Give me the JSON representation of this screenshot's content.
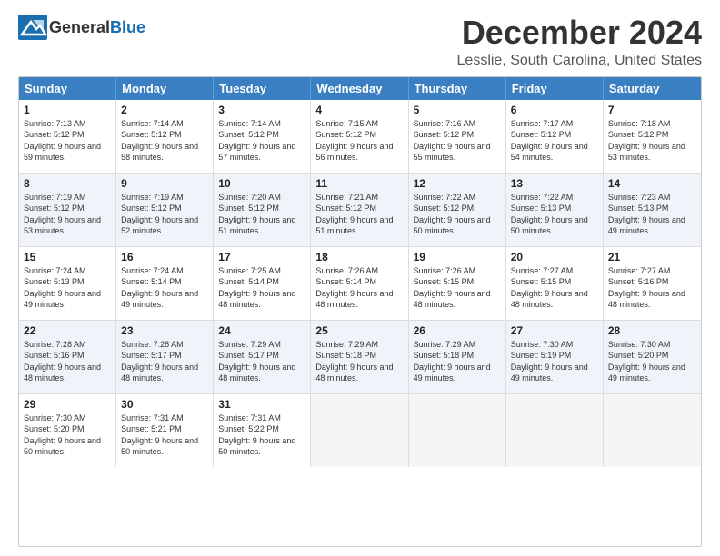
{
  "header": {
    "logo_general": "General",
    "logo_blue": "Blue",
    "month_title": "December 2024",
    "location": "Lesslie, South Carolina, United States"
  },
  "days_of_week": [
    "Sunday",
    "Monday",
    "Tuesday",
    "Wednesday",
    "Thursday",
    "Friday",
    "Saturday"
  ],
  "weeks": [
    {
      "cells": [
        {
          "day": "1",
          "sunrise": "Sunrise: 7:13 AM",
          "sunset": "Sunset: 5:12 PM",
          "daylight": "Daylight: 9 hours and 59 minutes.",
          "empty": false
        },
        {
          "day": "2",
          "sunrise": "Sunrise: 7:14 AM",
          "sunset": "Sunset: 5:12 PM",
          "daylight": "Daylight: 9 hours and 58 minutes.",
          "empty": false
        },
        {
          "day": "3",
          "sunrise": "Sunrise: 7:14 AM",
          "sunset": "Sunset: 5:12 PM",
          "daylight": "Daylight: 9 hours and 57 minutes.",
          "empty": false
        },
        {
          "day": "4",
          "sunrise": "Sunrise: 7:15 AM",
          "sunset": "Sunset: 5:12 PM",
          "daylight": "Daylight: 9 hours and 56 minutes.",
          "empty": false
        },
        {
          "day": "5",
          "sunrise": "Sunrise: 7:16 AM",
          "sunset": "Sunset: 5:12 PM",
          "daylight": "Daylight: 9 hours and 55 minutes.",
          "empty": false
        },
        {
          "day": "6",
          "sunrise": "Sunrise: 7:17 AM",
          "sunset": "Sunset: 5:12 PM",
          "daylight": "Daylight: 9 hours and 54 minutes.",
          "empty": false
        },
        {
          "day": "7",
          "sunrise": "Sunrise: 7:18 AM",
          "sunset": "Sunset: 5:12 PM",
          "daylight": "Daylight: 9 hours and 53 minutes.",
          "empty": false
        }
      ]
    },
    {
      "cells": [
        {
          "day": "8",
          "sunrise": "Sunrise: 7:19 AM",
          "sunset": "Sunset: 5:12 PM",
          "daylight": "Daylight: 9 hours and 53 minutes.",
          "empty": false
        },
        {
          "day": "9",
          "sunrise": "Sunrise: 7:19 AM",
          "sunset": "Sunset: 5:12 PM",
          "daylight": "Daylight: 9 hours and 52 minutes.",
          "empty": false
        },
        {
          "day": "10",
          "sunrise": "Sunrise: 7:20 AM",
          "sunset": "Sunset: 5:12 PM",
          "daylight": "Daylight: 9 hours and 51 minutes.",
          "empty": false
        },
        {
          "day": "11",
          "sunrise": "Sunrise: 7:21 AM",
          "sunset": "Sunset: 5:12 PM",
          "daylight": "Daylight: 9 hours and 51 minutes.",
          "empty": false
        },
        {
          "day": "12",
          "sunrise": "Sunrise: 7:22 AM",
          "sunset": "Sunset: 5:12 PM",
          "daylight": "Daylight: 9 hours and 50 minutes.",
          "empty": false
        },
        {
          "day": "13",
          "sunrise": "Sunrise: 7:22 AM",
          "sunset": "Sunset: 5:13 PM",
          "daylight": "Daylight: 9 hours and 50 minutes.",
          "empty": false
        },
        {
          "day": "14",
          "sunrise": "Sunrise: 7:23 AM",
          "sunset": "Sunset: 5:13 PM",
          "daylight": "Daylight: 9 hours and 49 minutes.",
          "empty": false
        }
      ]
    },
    {
      "cells": [
        {
          "day": "15",
          "sunrise": "Sunrise: 7:24 AM",
          "sunset": "Sunset: 5:13 PM",
          "daylight": "Daylight: 9 hours and 49 minutes.",
          "empty": false
        },
        {
          "day": "16",
          "sunrise": "Sunrise: 7:24 AM",
          "sunset": "Sunset: 5:14 PM",
          "daylight": "Daylight: 9 hours and 49 minutes.",
          "empty": false
        },
        {
          "day": "17",
          "sunrise": "Sunrise: 7:25 AM",
          "sunset": "Sunset: 5:14 PM",
          "daylight": "Daylight: 9 hours and 48 minutes.",
          "empty": false
        },
        {
          "day": "18",
          "sunrise": "Sunrise: 7:26 AM",
          "sunset": "Sunset: 5:14 PM",
          "daylight": "Daylight: 9 hours and 48 minutes.",
          "empty": false
        },
        {
          "day": "19",
          "sunrise": "Sunrise: 7:26 AM",
          "sunset": "Sunset: 5:15 PM",
          "daylight": "Daylight: 9 hours and 48 minutes.",
          "empty": false
        },
        {
          "day": "20",
          "sunrise": "Sunrise: 7:27 AM",
          "sunset": "Sunset: 5:15 PM",
          "daylight": "Daylight: 9 hours and 48 minutes.",
          "empty": false
        },
        {
          "day": "21",
          "sunrise": "Sunrise: 7:27 AM",
          "sunset": "Sunset: 5:16 PM",
          "daylight": "Daylight: 9 hours and 48 minutes.",
          "empty": false
        }
      ]
    },
    {
      "cells": [
        {
          "day": "22",
          "sunrise": "Sunrise: 7:28 AM",
          "sunset": "Sunset: 5:16 PM",
          "daylight": "Daylight: 9 hours and 48 minutes.",
          "empty": false
        },
        {
          "day": "23",
          "sunrise": "Sunrise: 7:28 AM",
          "sunset": "Sunset: 5:17 PM",
          "daylight": "Daylight: 9 hours and 48 minutes.",
          "empty": false
        },
        {
          "day": "24",
          "sunrise": "Sunrise: 7:29 AM",
          "sunset": "Sunset: 5:17 PM",
          "daylight": "Daylight: 9 hours and 48 minutes.",
          "empty": false
        },
        {
          "day": "25",
          "sunrise": "Sunrise: 7:29 AM",
          "sunset": "Sunset: 5:18 PM",
          "daylight": "Daylight: 9 hours and 48 minutes.",
          "empty": false
        },
        {
          "day": "26",
          "sunrise": "Sunrise: 7:29 AM",
          "sunset": "Sunset: 5:18 PM",
          "daylight": "Daylight: 9 hours and 49 minutes.",
          "empty": false
        },
        {
          "day": "27",
          "sunrise": "Sunrise: 7:30 AM",
          "sunset": "Sunset: 5:19 PM",
          "daylight": "Daylight: 9 hours and 49 minutes.",
          "empty": false
        },
        {
          "day": "28",
          "sunrise": "Sunrise: 7:30 AM",
          "sunset": "Sunset: 5:20 PM",
          "daylight": "Daylight: 9 hours and 49 minutes.",
          "empty": false
        }
      ]
    },
    {
      "cells": [
        {
          "day": "29",
          "sunrise": "Sunrise: 7:30 AM",
          "sunset": "Sunset: 5:20 PM",
          "daylight": "Daylight: 9 hours and 50 minutes.",
          "empty": false
        },
        {
          "day": "30",
          "sunrise": "Sunrise: 7:31 AM",
          "sunset": "Sunset: 5:21 PM",
          "daylight": "Daylight: 9 hours and 50 minutes.",
          "empty": false
        },
        {
          "day": "31",
          "sunrise": "Sunrise: 7:31 AM",
          "sunset": "Sunset: 5:22 PM",
          "daylight": "Daylight: 9 hours and 50 minutes.",
          "empty": false
        },
        {
          "day": "",
          "sunrise": "",
          "sunset": "",
          "daylight": "",
          "empty": true
        },
        {
          "day": "",
          "sunrise": "",
          "sunset": "",
          "daylight": "",
          "empty": true
        },
        {
          "day": "",
          "sunrise": "",
          "sunset": "",
          "daylight": "",
          "empty": true
        },
        {
          "day": "",
          "sunrise": "",
          "sunset": "",
          "daylight": "",
          "empty": true
        }
      ]
    }
  ]
}
